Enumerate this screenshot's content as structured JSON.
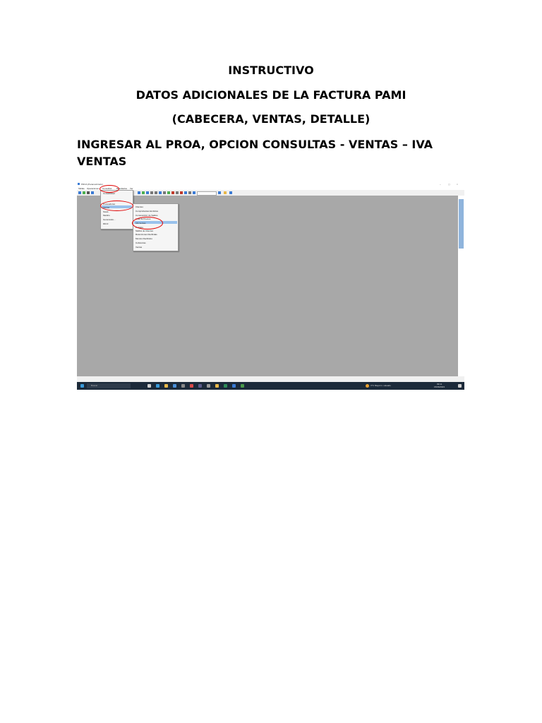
{
  "document": {
    "title": "INSTRUCTIVO",
    "subtitle": "DATOS ADICIONALES DE LA FACTURA PAMI",
    "subtitle2": "(CABECERA, VENTAS, DETALLE)",
    "step": "INGRESAR AL PROA, OPCION CONSULTAS - VENTAS – IVA VENTAS"
  },
  "screenshot": {
    "window_title": "PROA (Parametrizado)",
    "menu": [
      "Tablas",
      "Operaciones",
      "Consultas",
      "Resultados",
      "Ver"
    ],
    "consultas_menu": [
      "Contabilidad",
      "Proveedores",
      "Ventas",
      "Stock",
      "Medico",
      "Generando...",
      "DDJJ"
    ],
    "ventas_menu": [
      "Clientes",
      "Comprobantes Emitidos",
      "Composición de Saldos",
      "Lista de Precios",
      "IVA Ventas",
      "Pedidos",
      "Saldos de Clientes",
      "Retenciones Recibidas",
      "Montos Recibidos",
      "Cobranzas",
      "Ventas"
    ],
    "taskbar": {
      "search_placeholder": "Buscar",
      "weather": "3°C  Mayorm. soleado",
      "time": "09:11",
      "date": "15/06/2023"
    },
    "highlight_color": "#99c2ec",
    "annotation_color": "#e00000"
  }
}
